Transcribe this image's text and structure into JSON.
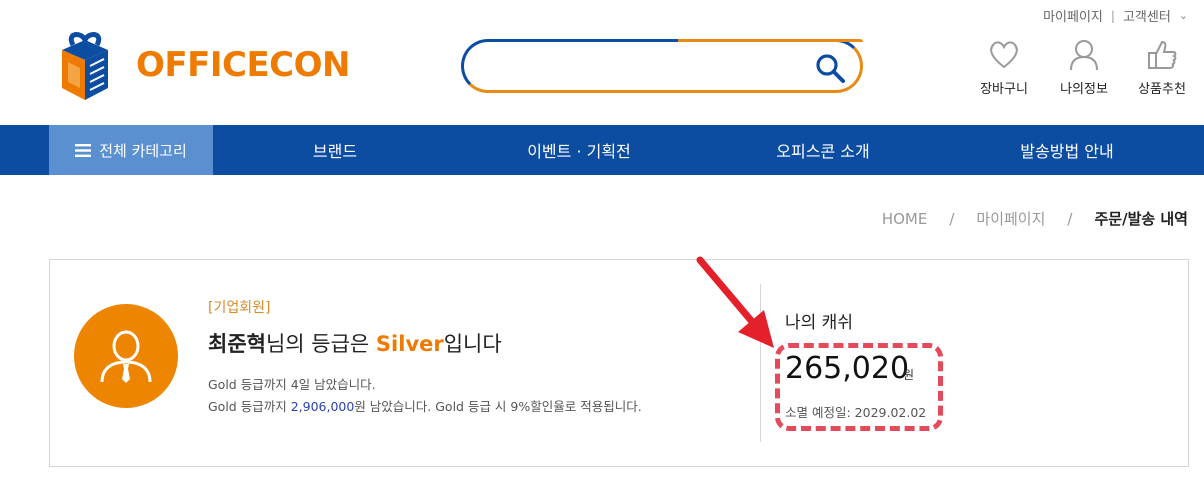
{
  "util_links": {
    "mypage": "마이페이지",
    "sep": "|",
    "support": "고객센터",
    "support_chevron": "chevron-down-icon"
  },
  "logo": {
    "text": "OFFICECON",
    "icon": "gift-box-icon"
  },
  "search": {
    "value": "",
    "placeholder": "",
    "icon": "search-icon"
  },
  "header_icons": [
    {
      "label": "장바구니",
      "icon": "heart-icon"
    },
    {
      "label": "나의정보",
      "icon": "user-icon"
    },
    {
      "label": "상품추천",
      "icon": "thumbs-up-icon"
    }
  ],
  "nav": {
    "category_label": "전체 카테고리",
    "items": [
      "브랜드",
      "이벤트 · 기획전",
      "오피스콘 소개",
      "발송방법 안내"
    ]
  },
  "breadcrumb": {
    "home": "HOME",
    "sep": "/",
    "mypage": "마이페이지",
    "current": "주문/발송 내역"
  },
  "member": {
    "type": "[기업회원]",
    "name": "최준혁",
    "grade_prefix": "님의 등급은 ",
    "grade": "Silver",
    "grade_suffix": "입니다",
    "note1": "Gold 등급까지 4일 남았습니다.",
    "note2_prefix": "Gold 등급까지 ",
    "note2_amount": "2,906,000",
    "note2_suffix": "원 남았습니다. Gold 등급 시 9%할인율로 적용됩니다."
  },
  "cash": {
    "label": "나의 캐쉬",
    "amount": "265,020",
    "unit": "원",
    "expire": "소멸 예정일: 2029.02.02"
  },
  "colors": {
    "brand_blue": "#0c4da2",
    "brand_orange": "#ee7b00",
    "highlight_red": "#e34a5a"
  }
}
